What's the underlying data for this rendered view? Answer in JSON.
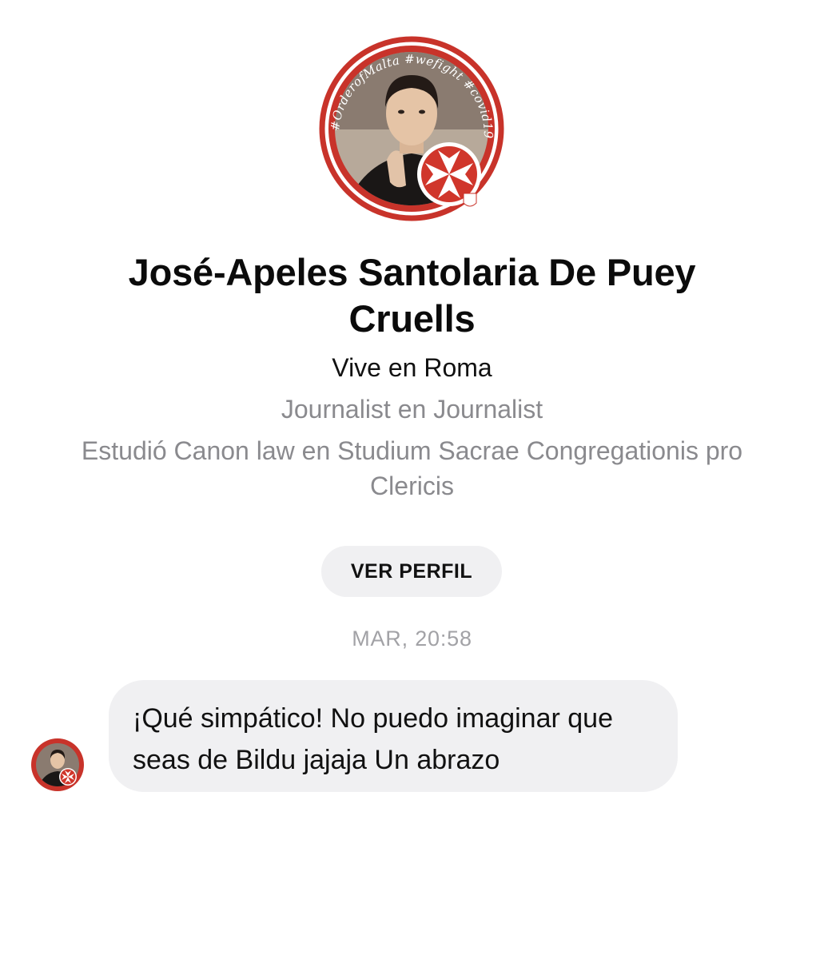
{
  "profile": {
    "avatar_ring_text": "#OrderofMalta #wefight #covid19",
    "name": "José-Apeles Santolaria De Puey Cruells",
    "location": "Vive en Roma",
    "work": "Journalist en Journalist",
    "education": "Estudió Canon law en Studium Sacrae Congregationis pro Clericis",
    "view_profile_label": "VER PERFIL"
  },
  "conversation": {
    "timestamp": "MAR, 20:58",
    "messages": [
      {
        "sender": "incoming",
        "text": "¡Qué simpático! No puedo imaginar que seas de Bildu jajaja Un abrazo"
      }
    ]
  },
  "icons": {
    "profile_avatar": "profile-photo-with-malta-cross-frame",
    "sender_avatar": "sender-avatar"
  },
  "colors": {
    "frame_red": "#c8332a",
    "bubble_bg": "#f0f0f2",
    "secondary_text": "#8a8a8e",
    "timestamp_text": "#a2a2a6"
  }
}
